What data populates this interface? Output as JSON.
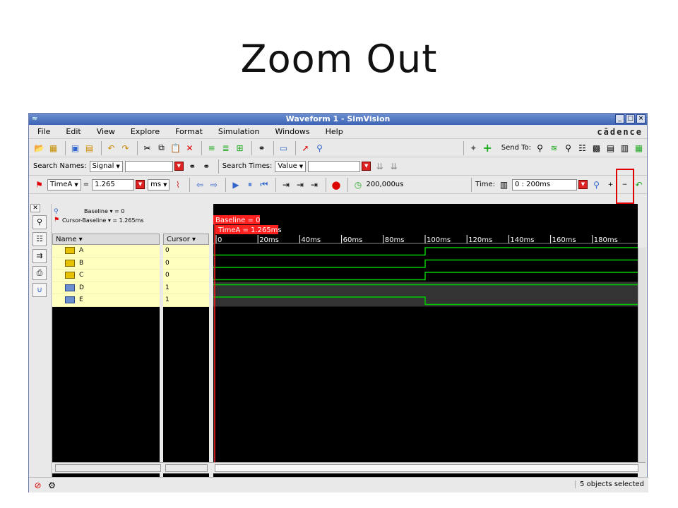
{
  "slide": {
    "title": "Zoom Out"
  },
  "window": {
    "title": "Waveform 1 - SimVision",
    "brand": "cādence"
  },
  "menus": [
    "File",
    "Edit",
    "View",
    "Explore",
    "Format",
    "Simulation",
    "Windows",
    "Help"
  ],
  "toolbar1": {
    "send_to_label": "Send To:"
  },
  "search_bar": {
    "names_label": "Search Names:",
    "names_mode": "Signal",
    "times_label": "Search Times:",
    "times_mode": "Value"
  },
  "cursor_bar": {
    "marker": "TimeA",
    "equals": "=",
    "value": "1.265",
    "unit": "ms",
    "sim_time": "200,000us",
    "time_label": "Time:",
    "time_range": "0 : 200ms",
    "icon_x2": "x2"
  },
  "name_pane": {
    "baseline_line": "Baseline ▾ = 0",
    "cursor_baseline_line": "Cursor-Baseline ▾ = 1.265ms",
    "header": "Name ▾"
  },
  "cursor_pane": {
    "header": "Cursor ▾"
  },
  "signals": [
    {
      "name": "A",
      "cursor": "0",
      "kind": "input"
    },
    {
      "name": "B",
      "cursor": "0",
      "kind": "input"
    },
    {
      "name": "C",
      "cursor": "0",
      "kind": "input"
    },
    {
      "name": "D",
      "cursor": "1",
      "kind": "wire"
    },
    {
      "name": "E",
      "cursor": "1",
      "kind": "wire"
    }
  ],
  "waveform": {
    "baseline_tag": "Baseline = 0",
    "timea_tag": "TimeA = 1.265ms",
    "ticks": [
      "0",
      "20ms",
      "40ms",
      "60ms",
      "80ms",
      "100ms",
      "120ms",
      "140ms",
      "160ms",
      "180ms"
    ],
    "transition_ms": 100,
    "range_ms": 200,
    "colors": {
      "wave": "#00cc00",
      "cursor": "#ff2020",
      "bg": "#000000"
    }
  },
  "status": {
    "text": "5 objects selected"
  }
}
